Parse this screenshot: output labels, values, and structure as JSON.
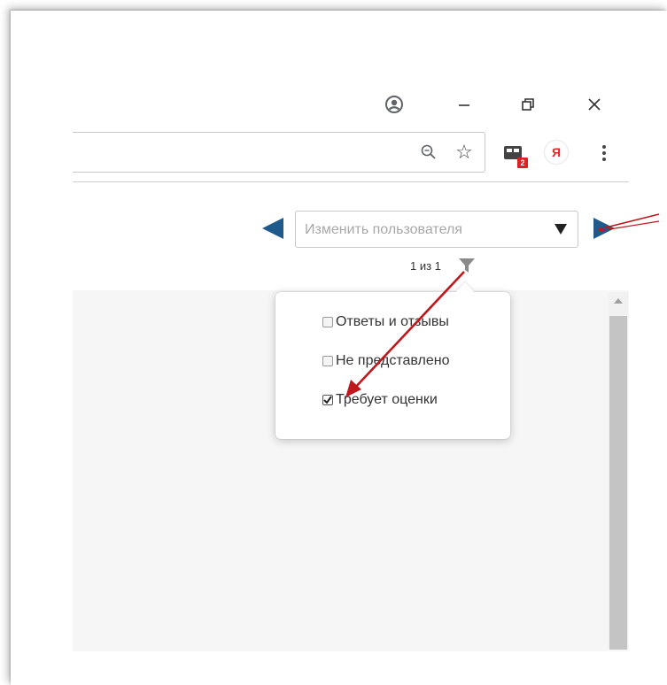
{
  "window_controls": {
    "account": "account-circle-icon",
    "minimize": "minimize-icon",
    "restore": "restore-icon",
    "close": "close-icon"
  },
  "address_bar": {
    "value": "",
    "icons": [
      "zoom-icon",
      "star-icon"
    ]
  },
  "extensions": {
    "bookmark_badge": "2",
    "yandex_label": "Я"
  },
  "user_selector": {
    "placeholder": "Изменить пользователя"
  },
  "pager": {
    "text": "1 из 1"
  },
  "filter_popover": {
    "options": [
      {
        "label": "Ответы и отзывы",
        "checked": false
      },
      {
        "label": "Не представлено",
        "checked": false
      },
      {
        "label": "Требует оценки",
        "checked": true
      }
    ]
  },
  "colors": {
    "nav_arrow": "#1f5a8c",
    "annotation_arrow": "#c0171c",
    "badge": "#e02020",
    "scroll_thumb": "#c4c4c4"
  }
}
